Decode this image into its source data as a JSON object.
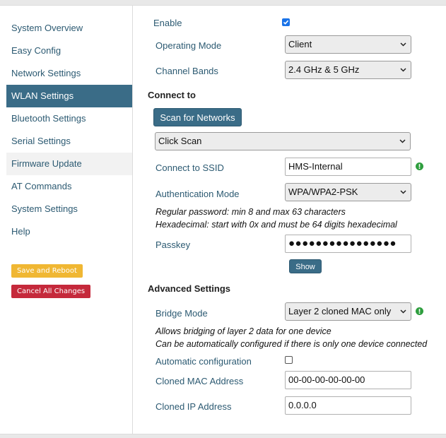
{
  "sidebar": {
    "items": [
      {
        "label": "System Overview"
      },
      {
        "label": "Easy Config"
      },
      {
        "label": "Network Settings"
      },
      {
        "label": "WLAN Settings"
      },
      {
        "label": "Bluetooth Settings"
      },
      {
        "label": "Serial Settings"
      },
      {
        "label": "Firmware Update"
      },
      {
        "label": "AT Commands"
      },
      {
        "label": "System Settings"
      },
      {
        "label": "Help"
      }
    ],
    "save_label": "Save and Reboot",
    "cancel_label": "Cancel All Changes"
  },
  "form": {
    "enable_label": "Enable",
    "enable_checked": true,
    "operating_mode_label": "Operating Mode",
    "operating_mode_value": "Client",
    "channel_bands_label": "Channel Bands",
    "channel_bands_value": "2.4 GHz & 5 GHz",
    "connect_heading": "Connect to",
    "scan_button": "Scan for Networks",
    "scan_select_value": "Click Scan",
    "ssid_label": "Connect to SSID",
    "ssid_value": "HMS-Internal",
    "auth_label": "Authentication Mode",
    "auth_value": "WPA/WPA2-PSK",
    "password_note_1": "Regular password: min 8 and max 63 characters",
    "password_note_2": "Hexadecimal: start with 0x and must be 64 digits hexadecimal",
    "passkey_label": "Passkey",
    "passkey_value": "●●●●●●●●●●●●●●●●",
    "show_button": "Show",
    "advanced_heading": "Advanced Settings",
    "bridge_label": "Bridge Mode",
    "bridge_value": "Layer 2 cloned MAC only",
    "bridge_note_1": "Allows bridging of layer 2 data for one device",
    "bridge_note_2": "Can be automatically configured if there is only one device connected",
    "auto_config_label": "Automatic configuration",
    "auto_config_checked": false,
    "cloned_mac_label": "Cloned MAC Address",
    "cloned_mac_value": "00-00-00-00-00-00",
    "cloned_ip_label": "Cloned IP Address",
    "cloned_ip_value": "0.0.0.0"
  },
  "colors": {
    "accent": "#3a6c87",
    "link": "#2c5a72",
    "save": "#f0b733",
    "cancel": "#c5293b",
    "info": "#2e9e3e"
  },
  "icons": {
    "chevron": "chevron-down-icon",
    "info": "info-icon"
  }
}
